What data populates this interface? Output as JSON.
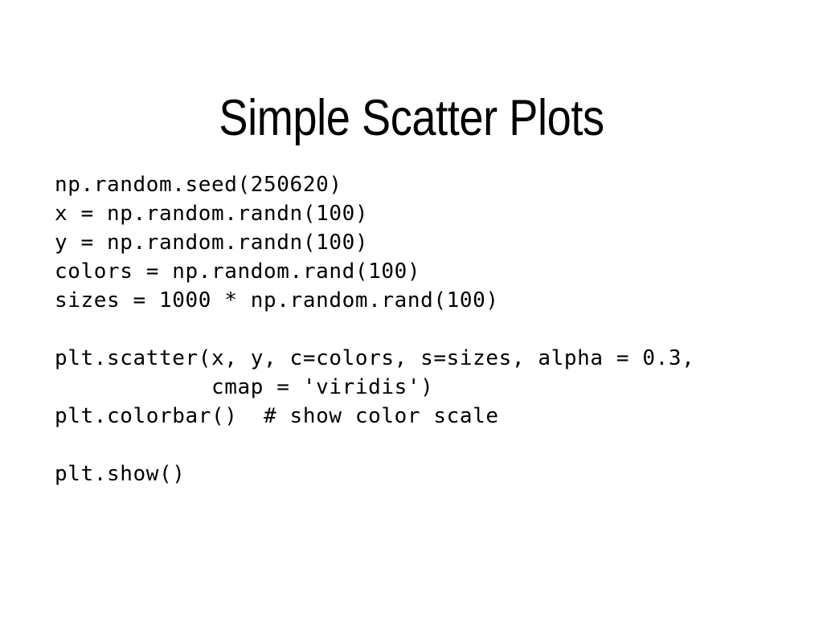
{
  "slide": {
    "title": "Simple Scatter Plots",
    "background_color": "#ffffff",
    "text_color": "#000000",
    "code_lines": [
      "np.random.seed(250620)",
      "x = np.random.randn(100)",
      "y = np.random.randn(100)",
      "colors = np.random.rand(100)",
      "sizes = 1000 * np.random.rand(100)",
      "",
      "plt.scatter(x, y, c=colors, s=sizes, alpha = 0.3,",
      "            cmap = 'viridis')",
      "plt.colorbar()  # show color scale",
      "",
      "plt.show()"
    ]
  }
}
